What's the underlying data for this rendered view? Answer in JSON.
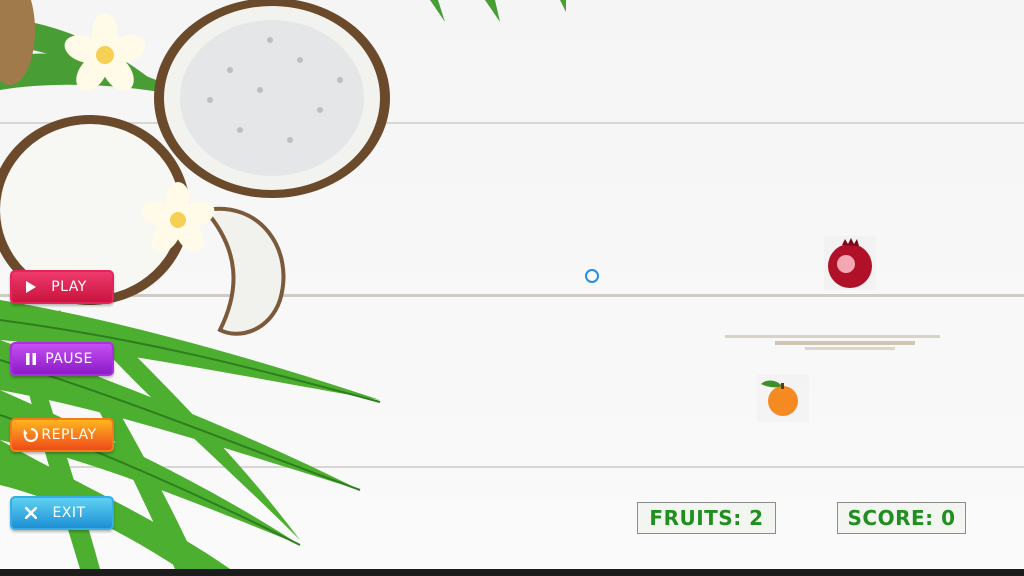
{
  "game": {
    "controls": [
      {
        "label": "PLAY",
        "icon": "play-icon"
      },
      {
        "label": "PAUSE",
        "icon": "pause-icon"
      },
      {
        "label": "REPLAY",
        "icon": "replay-icon"
      },
      {
        "label": "EXIT",
        "icon": "close-icon"
      }
    ],
    "hud": {
      "fruits_text": "FRUITS: 2",
      "score_text": "SCORE: 0"
    },
    "fruits_on_board": [
      "pomegranate",
      "orange"
    ]
  },
  "colors": {
    "play": "#e6245a",
    "pause": "#a92fe0",
    "replay": "#f57a1b",
    "exit": "#34aee6",
    "hud_text": "#1f8f1f",
    "cursor": "#2a8ee0"
  }
}
